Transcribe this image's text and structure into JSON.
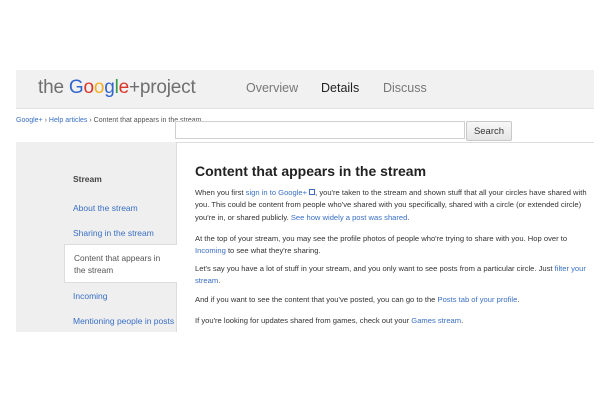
{
  "header": {
    "logo": {
      "prefix": "the ",
      "google_letters": [
        "G",
        "o",
        "o",
        "g",
        "l",
        "e"
      ],
      "suffix": "+project"
    },
    "nav": [
      {
        "label": "Overview",
        "active": false
      },
      {
        "label": "Details",
        "active": true
      },
      {
        "label": "Discuss",
        "active": false
      }
    ]
  },
  "breadcrumb": {
    "item1": "Google+",
    "sep": " › ",
    "item2": "Help articles",
    "item3": "Content that appears in the stream"
  },
  "search": {
    "value": "",
    "button": "Search"
  },
  "sidebar": {
    "title": "Stream",
    "items": [
      {
        "label": "About the stream"
      },
      {
        "label": "Sharing in the stream"
      },
      {
        "label": "Content that appears in the stream",
        "active": true
      },
      {
        "label": "Incoming"
      },
      {
        "label": "Mentioning people in posts"
      }
    ]
  },
  "content": {
    "title": "Content that appears in the stream",
    "p1": {
      "t1": "When you first ",
      "link1": "sign in to Google+",
      "t2": ", you're taken to the stream and shown stuff that all your circles have shared with you. This could be content from people who've shared with you specifically, shared with a circle (or extended circle) you're in, or shared publicly. ",
      "link2": "See how widely a post was shared",
      "t3": "."
    },
    "p2": {
      "t1": "At the top of your stream, you may see the profile photos of people who're trying to share with you. Hop over to ",
      "link1": "Incoming",
      "t2": " to see what they're sharing."
    },
    "p3": {
      "t1": "Let's say you have a lot of stuff in your stream, and you only want to see posts from a particular circle. Just ",
      "link1": "filter your stream",
      "t2": "."
    },
    "p4": {
      "t1": "And if you want to see the content that you've posted, you can go to the ",
      "link1": "Posts tab of your profile",
      "t2": "."
    },
    "p5": {
      "t1": "If you're looking for updates shared from games, check out your ",
      "link1": "Games stream",
      "t2": "."
    }
  },
  "colors": {
    "link": "#3a6fc4",
    "header_bg": "#f1f1f1",
    "sidebar_bg": "#efefef"
  }
}
